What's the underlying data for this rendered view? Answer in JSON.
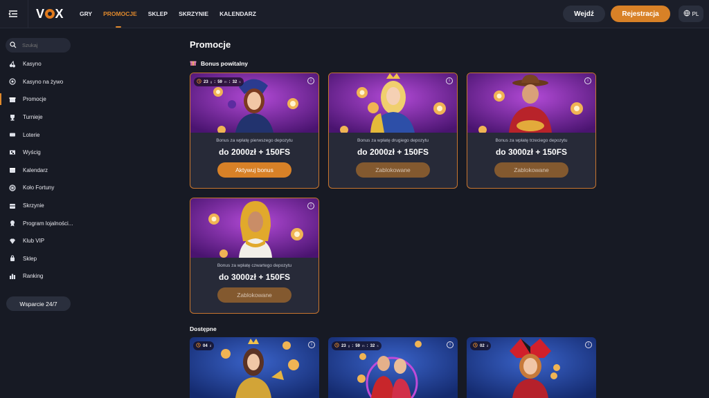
{
  "brand": {
    "name": "VOX"
  },
  "nav": [
    {
      "label": "GRY",
      "active": false
    },
    {
      "label": "PROMOCJE",
      "active": true
    },
    {
      "label": "SKLEP",
      "active": false
    },
    {
      "label": "SKRZYNIE",
      "active": false
    },
    {
      "label": "KALENDARZ",
      "active": false
    }
  ],
  "header": {
    "login_label": "Wejdź",
    "register_label": "Rejestracja",
    "lang": "PL"
  },
  "sidebar": {
    "search_placeholder": "Szukaj",
    "items": [
      {
        "label": "Kasyno",
        "icon": "cherry-icon"
      },
      {
        "label": "Kasyno na żywo",
        "icon": "chip-icon"
      },
      {
        "label": "Promocje",
        "icon": "gift-icon",
        "active": true
      },
      {
        "label": "Turnieje",
        "icon": "trophy-icon"
      },
      {
        "label": "Loterie",
        "icon": "ticket-icon"
      },
      {
        "label": "Wyścig",
        "icon": "flag-icon"
      },
      {
        "label": "Kalendarz",
        "icon": "calendar-icon"
      },
      {
        "label": "Koło Fortuny",
        "icon": "wheel-icon"
      },
      {
        "label": "Skrzynie",
        "icon": "chest-icon"
      },
      {
        "label": "Program lojalności...",
        "icon": "medal-icon"
      },
      {
        "label": "Klub VIP",
        "icon": "diamond-icon"
      },
      {
        "label": "Sklep",
        "icon": "bag-icon"
      },
      {
        "label": "Ranking",
        "icon": "ranking-icon"
      }
    ],
    "support_label": "Wsparcie 24/7"
  },
  "main": {
    "title": "Promocje",
    "welcome_section": "Bonus powitalny",
    "available_section": "Dostępne",
    "welcome_cards": [
      {
        "timer": {
          "d": "23",
          "d_unit": "g",
          "h": "59",
          "h_unit": "m",
          "s": "32",
          "s_unit": "s"
        },
        "subtitle": "Bonus za wpłatę pierwszego depozytu",
        "amount": "do 2000zł + 150FS",
        "button": "Aktywuj bonus",
        "locked": false
      },
      {
        "subtitle": "Bonus za wpłatę drugiego depozytu",
        "amount": "do 2000zł + 150FS",
        "button": "Zablokowane",
        "locked": true
      },
      {
        "subtitle": "Bonus za wpłatę trzeciego depozytu",
        "amount": "do 3000zł + 150FS",
        "button": "Zablokowane",
        "locked": true
      },
      {
        "subtitle": "Bonus za wpłatę czwartego depozytu",
        "amount": "do 3000zł + 150FS",
        "button": "Zablokowane",
        "locked": true
      }
    ],
    "available_cards": [
      {
        "timer_text": "04",
        "timer_unit": "d"
      },
      {
        "timer": {
          "d": "23",
          "d_unit": "g",
          "h": "59",
          "h_unit": "m",
          "s": "32",
          "s_unit": "s"
        }
      },
      {
        "timer_text": "02",
        "timer_unit": "d"
      }
    ]
  },
  "colors": {
    "accent": "#d88127",
    "background": "#171a24",
    "card": "#272a38",
    "purple": "#6b1f91",
    "blue": "#1e3a8a"
  }
}
